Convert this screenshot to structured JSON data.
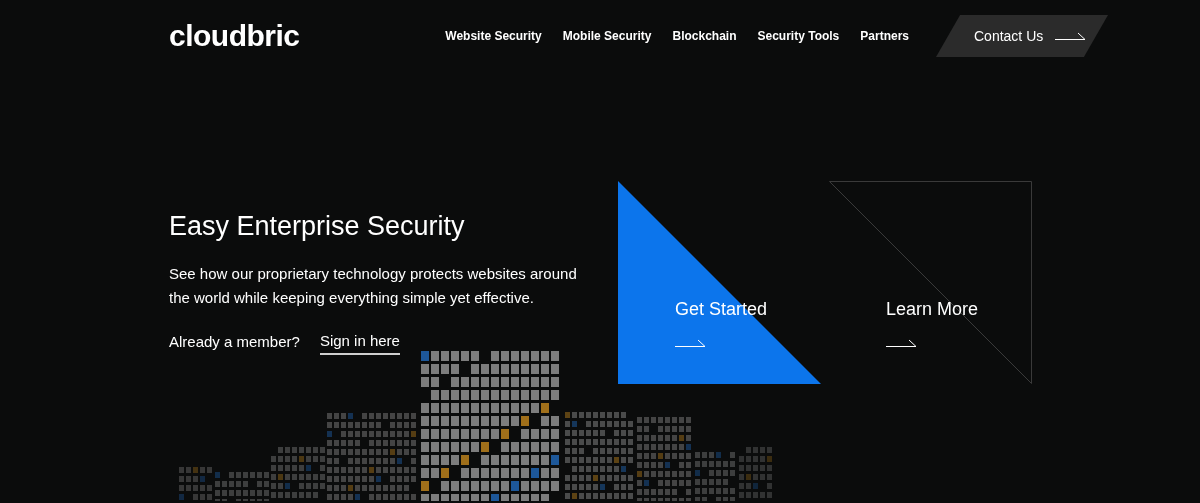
{
  "logo": {
    "text": "cloudbric"
  },
  "nav": [
    {
      "label": "Website Security"
    },
    {
      "label": "Mobile Security"
    },
    {
      "label": "Blockchain"
    },
    {
      "label": "Security Tools"
    },
    {
      "label": "Partners"
    }
  ],
  "contact_button": {
    "label": "Contact Us"
  },
  "hero": {
    "title": "Easy Enterprise Security",
    "text": "See how our proprietary technology protects websites around the world while keeping everything simple yet effective.",
    "member_prompt": "Already a member?",
    "sign_in_link": "Sign in here"
  },
  "cards": [
    {
      "kind": "filled",
      "label": "Get Started"
    },
    {
      "kind": "outline",
      "label": "Learn More"
    }
  ]
}
